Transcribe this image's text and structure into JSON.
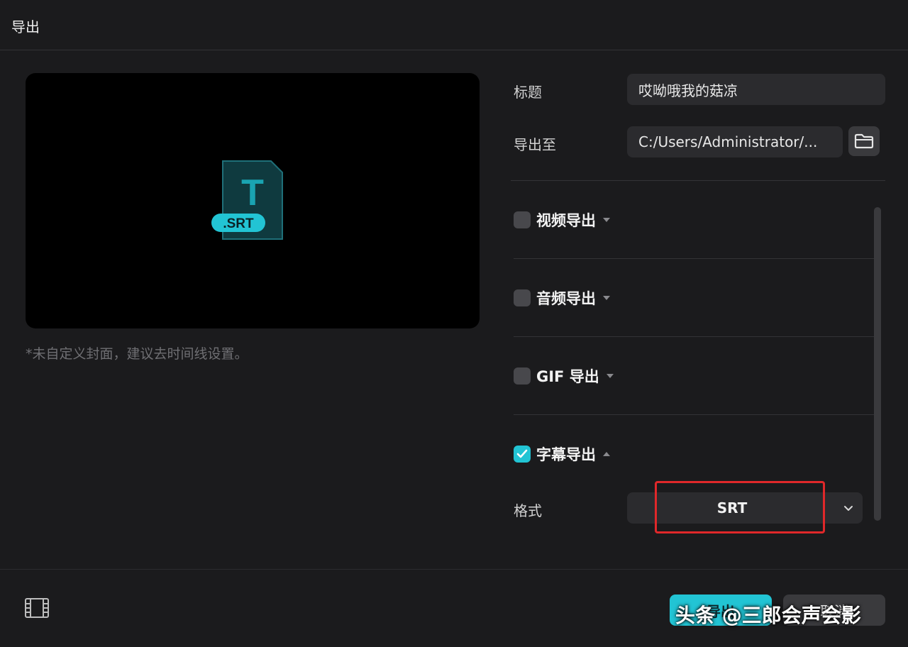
{
  "window": {
    "title": "导出"
  },
  "preview": {
    "file_badge": ".SRT",
    "file_letter": "T",
    "cover_hint": "*未自定义封面，建议去时间线设置。"
  },
  "form": {
    "title_label": "标题",
    "title_value": "哎呦哦我的菇凉",
    "path_label": "导出至",
    "path_value": "C:/Users/Administrator/...",
    "folder_icon": "folder-icon"
  },
  "sections": [
    {
      "label": "视频导出",
      "checked": false,
      "expanded": false
    },
    {
      "label": "音频导出",
      "checked": false,
      "expanded": false
    },
    {
      "label": "GIF 导出",
      "checked": false,
      "expanded": false
    },
    {
      "label": "字幕导出",
      "checked": true,
      "expanded": true
    }
  ],
  "subtitle": {
    "format_label": "格式",
    "format_value": "SRT"
  },
  "footer": {
    "export_label": "导出",
    "cancel_label": "取消",
    "watermark": "头条 @三郎会声会影"
  },
  "colors": {
    "accent": "#22c4d4",
    "highlight": "#e0282a",
    "background": "#1b1b1d"
  }
}
